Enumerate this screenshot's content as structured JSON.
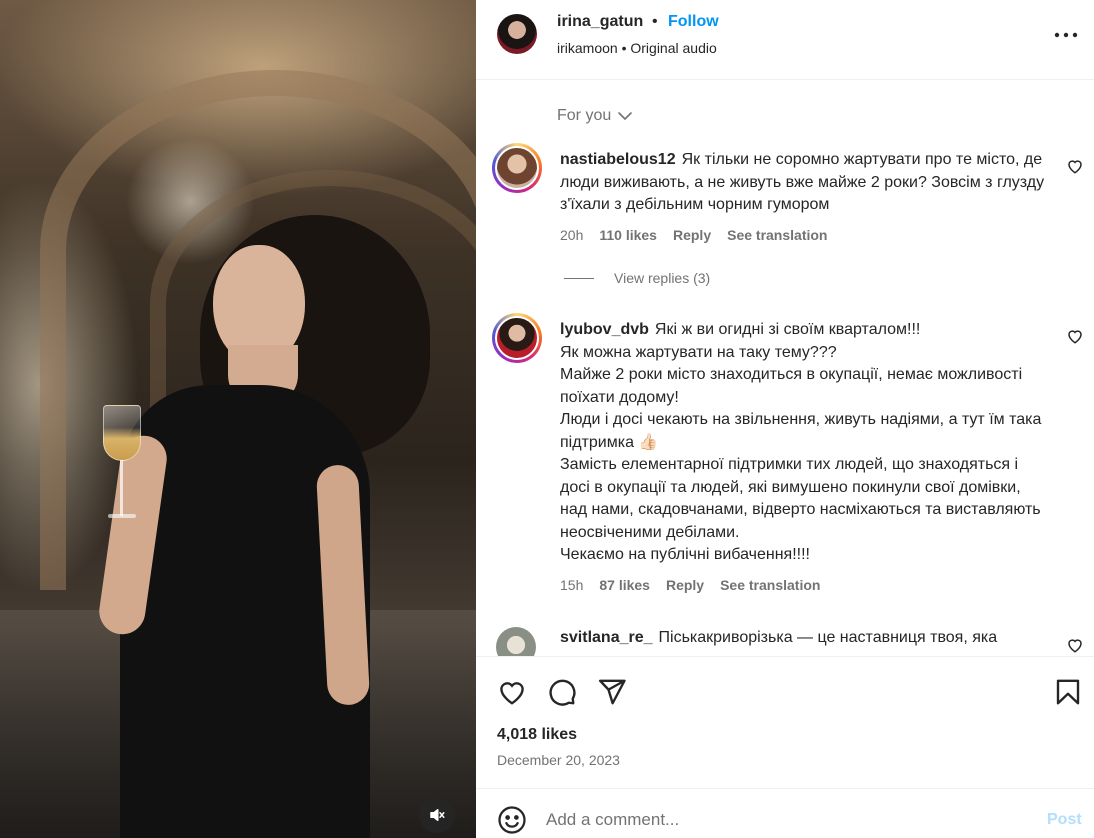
{
  "header": {
    "username": "irina_gatun",
    "separator": "•",
    "follow_label": "Follow",
    "audio_line": "irikamoon • Original audio",
    "more_icon": "more-horizontal-icon"
  },
  "comments_section": {
    "sort_label": "For you",
    "comments": [
      {
        "username": "nastiabelous12",
        "text": "Як тільки не соромно жартувати про те місто, де люди виживають, а не живуть вже майже 2 роки? Зовсім з глузду з'їхали з дебільним чорним гумором",
        "time": "20h",
        "likes": "110 likes",
        "reply": "Reply",
        "translate": "See translation",
        "view_replies": "View replies (3)"
      },
      {
        "username": "lyubov_dvb",
        "lines": [
          "Які ж ви огидні зі своїм кварталом!!!",
          "Як можна жартувати на таку тему???",
          "Майже 2 роки місто знаходиться в окупації, немає можливості поїхати додому!",
          "Люди і досі чекають на звільнення, живуть надіями, а тут їм така підтримка 👍🏻",
          "Замість елементарної підтримки тих людей, що знаходяться і досі в окупації та людей, які вимушено покинули свої домівки, над нами, скадовчанами, відверто насміхаються та виставляють неосвіченими дебілами.",
          "Чекаємо на публічні вибачення!!!!"
        ],
        "time": "15h",
        "likes": "87 likes",
        "reply": "Reply",
        "translate": "See translation"
      },
      {
        "username": "svitlana_re_",
        "text": "Піськакриворізька — це наставниця твоя, яка"
      }
    ]
  },
  "post": {
    "likes": "4,018 likes",
    "date": "December 20, 2023"
  },
  "add_comment": {
    "placeholder": "Add a comment...",
    "post_label": "Post"
  },
  "colors": {
    "accent": "#0095f6",
    "muted": "#737373",
    "text": "#262626",
    "post_disabled": "#b2dffc"
  }
}
